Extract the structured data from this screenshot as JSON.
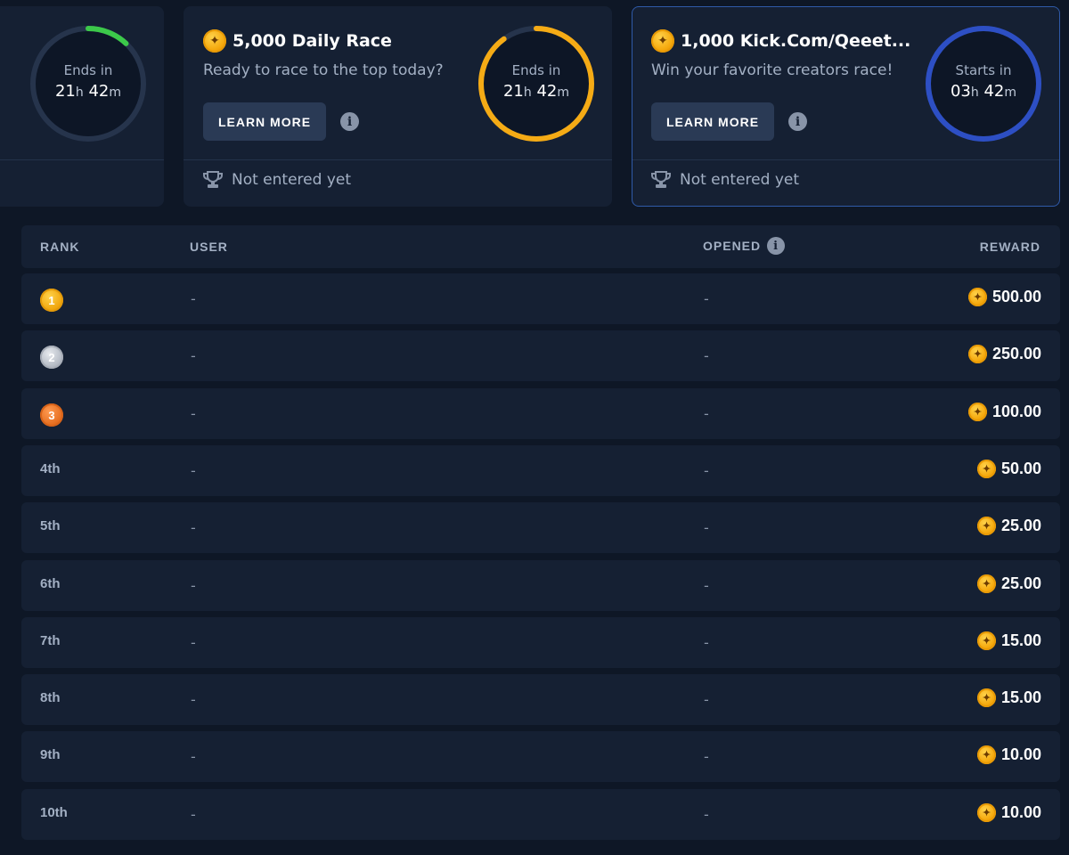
{
  "races": [
    {
      "title": "",
      "description": "",
      "timer_label": "Ends in",
      "timer_hours": "21",
      "timer_minutes": "42",
      "ring_color": "#3cc94a",
      "ring_progress": 0.12
    },
    {
      "title": "5,000 Daily Race",
      "description": "Ready to race to the top today?",
      "learn_more": "LEARN MORE",
      "info_icon": "info-icon",
      "status": "Not entered yet",
      "timer_label": "Ends in",
      "timer_hours": "21",
      "timer_minutes": "42",
      "ring_color": "#f5ab15",
      "ring_progress": 0.9
    },
    {
      "title": "1,000 Kick.Com/Qeeet...",
      "description": "Win your favorite creators race!",
      "learn_more": "LEARN MORE",
      "info_icon": "info-icon",
      "status": "Not entered yet",
      "timer_label": "Starts in",
      "timer_hours": "03",
      "timer_minutes": "42",
      "ring_color": "#2d4fc4",
      "ring_progress": 1.0
    }
  ],
  "time_units": {
    "h": "h",
    "m": "m"
  },
  "table": {
    "headers": {
      "rank": "RANK",
      "user": "USER",
      "opened": "OPENED",
      "reward": "REWARD"
    },
    "rows": [
      {
        "rank": "1",
        "medal": "gold",
        "user": "-",
        "opened": "-",
        "reward": "500.00"
      },
      {
        "rank": "2",
        "medal": "silver",
        "user": "-",
        "opened": "-",
        "reward": "250.00"
      },
      {
        "rank": "3",
        "medal": "bronze",
        "user": "-",
        "opened": "-",
        "reward": "100.00"
      },
      {
        "rank": "4th",
        "user": "-",
        "opened": "-",
        "reward": "50.00"
      },
      {
        "rank": "5th",
        "user": "-",
        "opened": "-",
        "reward": "25.00"
      },
      {
        "rank": "6th",
        "user": "-",
        "opened": "-",
        "reward": "25.00"
      },
      {
        "rank": "7th",
        "user": "-",
        "opened": "-",
        "reward": "15.00"
      },
      {
        "rank": "8th",
        "user": "-",
        "opened": "-",
        "reward": "15.00"
      },
      {
        "rank": "9th",
        "user": "-",
        "opened": "-",
        "reward": "10.00"
      },
      {
        "rank": "10th",
        "user": "-",
        "opened": "-",
        "reward": "10.00"
      }
    ]
  },
  "colors": {
    "background": "#0e1726",
    "card": "#152033",
    "accent_border": "#2f5aa8",
    "coin": "#f5a80c",
    "muted_text": "#a3b0c4"
  }
}
